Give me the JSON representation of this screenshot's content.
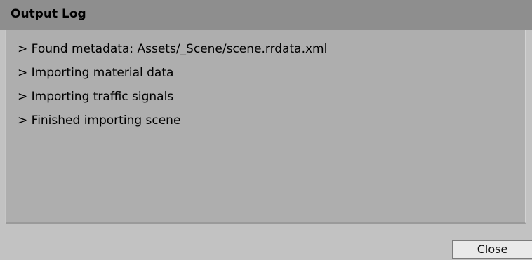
{
  "window": {
    "title": "Output Log"
  },
  "log": {
    "lines": [
      "> Found metadata: Assets/_Scene/scene.rrdata.xml",
      "> Importing material data",
      "> Importing traffic signals",
      "> Finished importing scene"
    ]
  },
  "footer": {
    "close_label": "Close"
  },
  "colors": {
    "title_bar": "#8e8e8e",
    "window_background": "#c2c2c2",
    "log_background": "#aeaeae",
    "button_background": "#e9e9e9"
  }
}
